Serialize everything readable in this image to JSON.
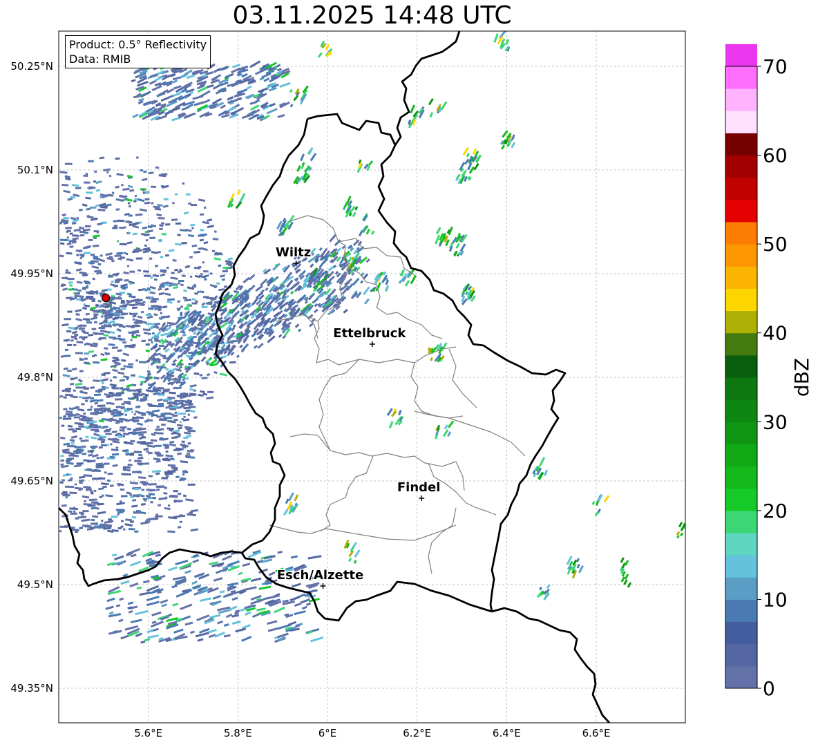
{
  "title": "03.11.2025 14:48 UTC",
  "info": {
    "product": "Product: 0.5° Reflectivity",
    "data_source": "Data: RMIB"
  },
  "map": {
    "lon_range": [
      5.4,
      6.8
    ],
    "lat_range": [
      49.3,
      50.3
    ],
    "x_ticks": [
      {
        "value": 5.6,
        "label": "5.6°E"
      },
      {
        "value": 5.8,
        "label": "5.8°E"
      },
      {
        "value": 6.0,
        "label": "6°E"
      },
      {
        "value": 6.2,
        "label": "6.2°E"
      },
      {
        "value": 6.4,
        "label": "6.4°E"
      },
      {
        "value": 6.6,
        "label": "6.6°E"
      }
    ],
    "y_ticks": [
      {
        "value": 50.25,
        "label": "50.25°N"
      },
      {
        "value": 50.1,
        "label": "50.1°N"
      },
      {
        "value": 49.95,
        "label": "49.95°N"
      },
      {
        "value": 49.8,
        "label": "49.8°N"
      },
      {
        "value": 49.65,
        "label": "49.65°N"
      },
      {
        "value": 49.5,
        "label": "49.5°N"
      },
      {
        "value": 49.35,
        "label": "49.35°N"
      }
    ],
    "cities": [
      {
        "name": "Wiltz",
        "lon": 5.93,
        "lat": 49.965
      },
      {
        "name": "Ettelbruck",
        "lon": 6.1,
        "lat": 49.848
      },
      {
        "name": "Findel",
        "lon": 6.21,
        "lat": 49.625
      },
      {
        "name": "Esch/Alzette",
        "lon": 5.99,
        "lat": 49.498
      }
    ],
    "radar_site": {
      "lon": 5.505,
      "lat": 49.915
    }
  },
  "colorbar": {
    "label": "dBZ",
    "min": 0,
    "max": 70,
    "step": 2.5,
    "ticks": [
      0,
      10,
      20,
      30,
      40,
      50,
      60,
      70
    ],
    "colors": [
      "#6272a9",
      "#5467a2",
      "#435d9e",
      "#4b79b1",
      "#5a9ec6",
      "#65c2dc",
      "#5fd6c0",
      "#3cd674",
      "#14c928",
      "#13b81b",
      "#11a916",
      "#0e9613",
      "#0d8711",
      "#0d7810",
      "#085e0c",
      "#457a0e",
      "#aeb006",
      "#fdd600",
      "#fcb402",
      "#fd9802",
      "#fd7d02",
      "#e40000",
      "#c10000",
      "#a20000",
      "#760000",
      "#ffe0ff",
      "#ffb3ff",
      "#ff6ffe",
      "#ea36ec"
    ]
  }
}
